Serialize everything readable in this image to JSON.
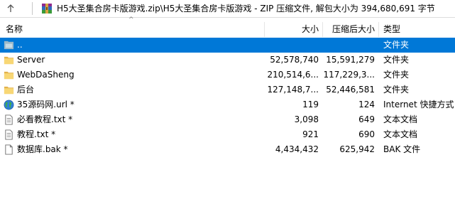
{
  "address": {
    "path": "H5大圣集合房卡版游戏.zip\\H5大圣集合房卡版游戏 - ZIP 压缩文件, 解包大小为 394,680,691 字节"
  },
  "columns": {
    "name": "名称",
    "size": "大小",
    "packed": "压缩后大小",
    "type": "类型"
  },
  "files": [
    {
      "icon": "folder-up-icon",
      "name": "..",
      "size": "",
      "packed": "",
      "type": "文件夹",
      "selected": true
    },
    {
      "icon": "folder-icon",
      "name": "Server",
      "size": "52,578,740",
      "packed": "15,591,279",
      "type": "文件夹"
    },
    {
      "icon": "folder-icon",
      "name": "WebDaSheng",
      "size": "210,514,6...",
      "packed": "117,229,3...",
      "type": "文件夹"
    },
    {
      "icon": "folder-icon",
      "name": "后台",
      "size": "127,148,7...",
      "packed": "52,446,581",
      "type": "文件夹"
    },
    {
      "icon": "globe-icon",
      "name": "35源码网.url *",
      "size": "119",
      "packed": "124",
      "type": "Internet 快捷方式"
    },
    {
      "icon": "text-file-icon",
      "name": "必看教程.txt *",
      "size": "3,098",
      "packed": "649",
      "type": "文本文档"
    },
    {
      "icon": "text-file-icon",
      "name": "教程.txt *",
      "size": "921",
      "packed": "690",
      "type": "文本文档"
    },
    {
      "icon": "blank-file-icon",
      "name": "数据库.bak *",
      "size": "4,434,432",
      "packed": "625,942",
      "type": "BAK 文件"
    }
  ],
  "colors": {
    "selection": "#0078d7",
    "folder": "#f8d775",
    "folder_dark": "#e2b24d"
  }
}
